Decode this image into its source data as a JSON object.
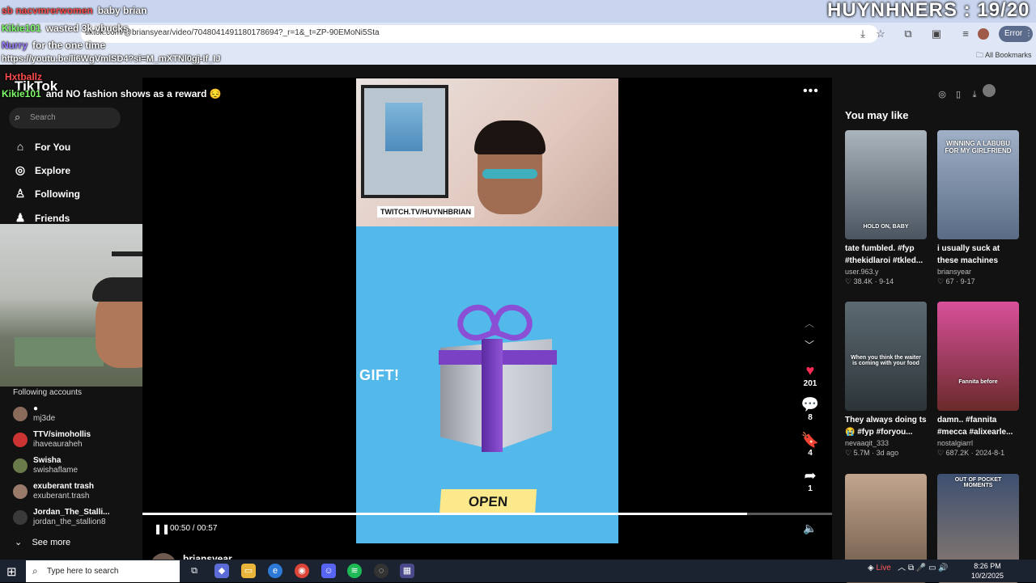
{
  "browser": {
    "url": "tiktok.com/@briansyear/video/7048041491180178694?_r=1&_t=ZP-90EMoNi5Sta",
    "error_label": "Error",
    "bookmarks_label": "All Bookmarks"
  },
  "overlay": {
    "counter": "HUYNHNERS : 19/20",
    "link": "https://youtu.be/li6WgVmlSD4?si=M_mXTNl0gj-If_IJ",
    "chat": [
      {
        "user": "sb nacvmrerwomen",
        "text": "baby brian"
      },
      {
        "user": "Kikie101",
        "text": "wasted 3k vbucks"
      },
      {
        "user": "Nurry",
        "text": "for the one time"
      },
      {
        "user": "Hxtballz",
        "text": ""
      },
      {
        "user": "Kikie101",
        "text": "and NO fashion shows as a reward 😔"
      }
    ]
  },
  "tiktok": {
    "logo": "TikTok",
    "search_placeholder": "Search",
    "nav": [
      {
        "icon": "home-icon",
        "label": "For You"
      },
      {
        "icon": "compass-icon",
        "label": "Explore"
      },
      {
        "icon": "following-icon",
        "label": "Following"
      },
      {
        "icon": "friends-icon",
        "label": "Friends"
      }
    ],
    "following_title": "Following accounts",
    "accounts": [
      {
        "name": "●",
        "handle": "mj3de"
      },
      {
        "name": "TTV/simohollis",
        "handle": "ihaveauraheh"
      },
      {
        "name": "Swisha",
        "handle": "swishaflame"
      },
      {
        "name": "exuberant trash",
        "handle": "exuberant.trash"
      },
      {
        "name": "Jordan_The_Stalli...",
        "handle": "jordan_the_stallion8"
      }
    ],
    "see_more": "See more"
  },
  "video": {
    "twitch_tag": "TWITCH.TV/HUYNHBRIAN",
    "gift_label": "GIFT!",
    "open_label": "OPEN",
    "time": "00:50 / 00:57",
    "progress": 0.877,
    "author": "briansyear",
    "actions": [
      {
        "icon": "heart-icon",
        "count": "201"
      },
      {
        "icon": "comment-icon",
        "count": "8"
      },
      {
        "icon": "bookmark-icon",
        "count": "4"
      },
      {
        "icon": "share-icon",
        "count": "1"
      }
    ]
  },
  "recommendations": {
    "title": "You may like",
    "cards": [
      {
        "caption": "tate fumbled. #fyp #thekidlaroi #tkled...",
        "user": "user.963.y",
        "meta": "♡ 38.4K · 9-14",
        "thumb_text": "HOLD ON, BABY",
        "color": "#5b6b7b"
      },
      {
        "caption": "i usually suck at these machines too...",
        "user": "briansyear",
        "meta": "♡ 67 · 9-17",
        "thumb_text": "WINNING A LABUBU FOR MY GIRLFRIEND",
        "color": "#7c8aa6"
      },
      {
        "caption": "They always doing ts 😭 #fyp #foryou...",
        "user": "nevaaqit_333",
        "meta": "♡ 5.7M · 3d ago",
        "thumb_text": "When you think the waiter is coming with your food",
        "color": "#3b4a55"
      },
      {
        "caption": "damn.. #fannita #mecca #alixearle...",
        "user": "nostalgiarrl",
        "meta": "♡ 687.2K · 2024-8-1",
        "thumb_text": "Fannita before",
        "color": "#8a4a6a"
      },
      {
        "caption": "",
        "user": "",
        "meta": "",
        "thumb_text": "",
        "color": "#8d7a6e"
      },
      {
        "caption": "",
        "user": "",
        "meta": "",
        "thumb_text": "OUT OF POCKET MOMENTS",
        "color": "#5a6f8c"
      }
    ]
  },
  "taskbar": {
    "search_placeholder": "Type here to search",
    "live_label": "Live",
    "time": "8:26 PM",
    "date": "10/2/2025"
  }
}
